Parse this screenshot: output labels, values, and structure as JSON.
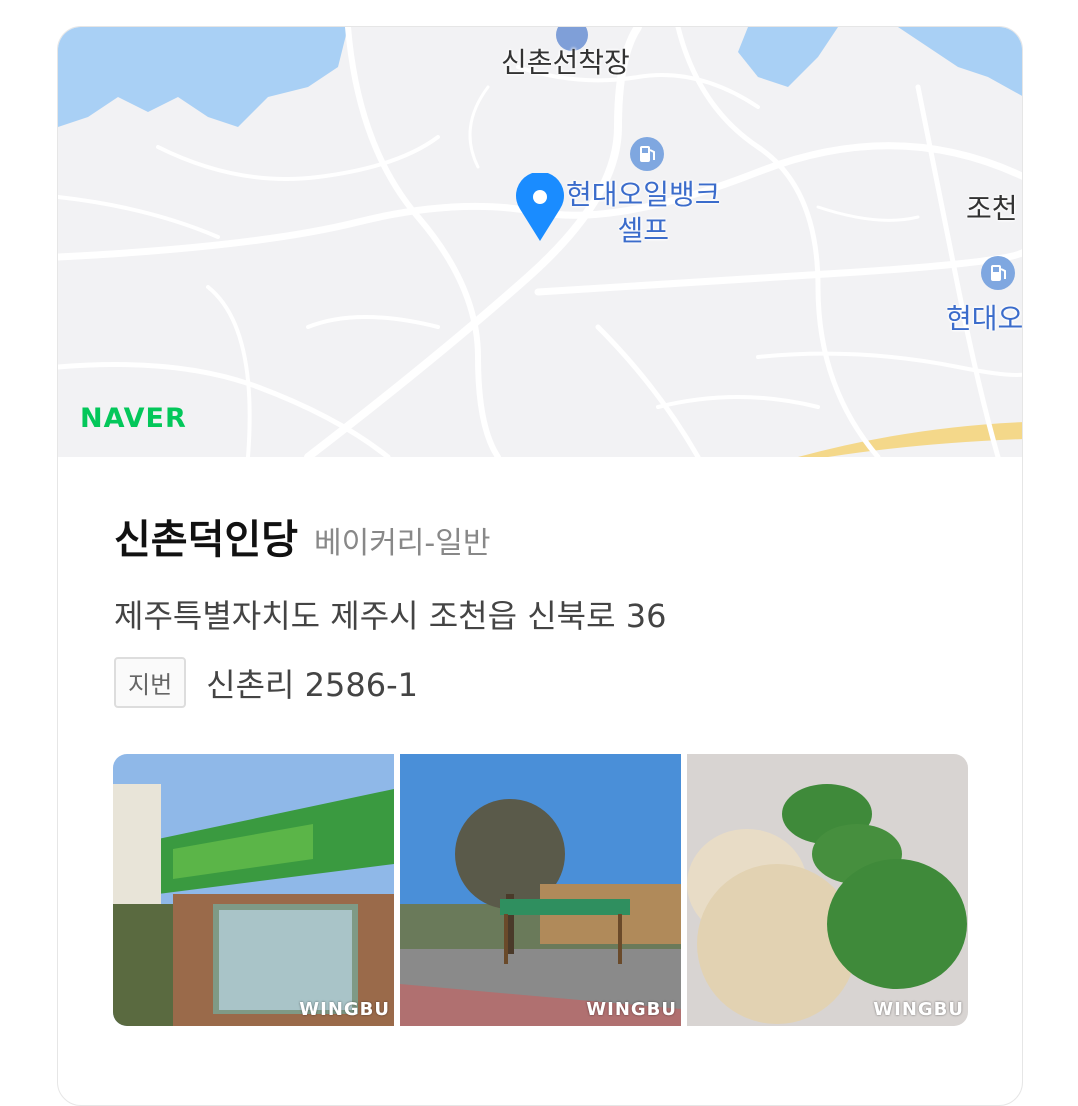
{
  "map": {
    "labels": {
      "pier": "신촌선착장",
      "gas_station_1": "현대오일뱅크\n셀프",
      "town": "조천",
      "gas_station_2": "현대오일"
    },
    "brand": "NAVER",
    "colors": {
      "water": "#a9d0f5",
      "road": "#ffffff",
      "land": "#f2f2f4",
      "pin": "#1a8cff",
      "highway": "#f4d88a"
    }
  },
  "place": {
    "name": "신촌덕인당",
    "category": "베이커리-일반",
    "address": "제주특별자치도 제주시 조천읍 신북로 36",
    "lot_badge": "지번",
    "lot_address": "신촌리 2586-1"
  },
  "photos": [
    {
      "name": "storefront",
      "watermark": "WINGBU"
    },
    {
      "name": "bus-stop",
      "watermark": "WINGBU"
    },
    {
      "name": "barley-bread",
      "watermark": "WINGBU"
    }
  ]
}
